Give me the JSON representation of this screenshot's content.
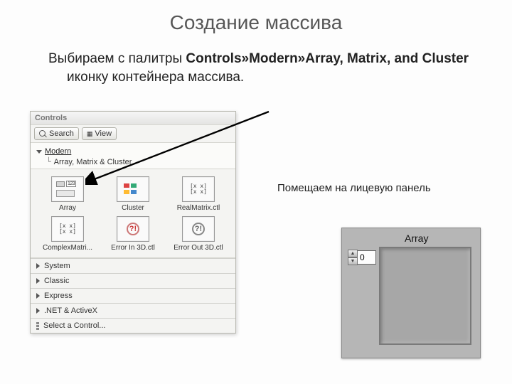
{
  "title": "Создание массива",
  "intro": {
    "pre": "Выбираем с палитры ",
    "bold": "Controls»Modern»Array, Matrix, and Cluster",
    "post": " иконку контейнера массива."
  },
  "palette": {
    "window_title": "Controls",
    "search_label": "Search",
    "view_label": "View",
    "tree": {
      "root": "Modern",
      "sub": "Array, Matrix & Cluster"
    },
    "items": [
      {
        "label": "Array"
      },
      {
        "label": "Cluster"
      },
      {
        "label": "RealMatrix.ctl"
      },
      {
        "label": "ComplexMatri..."
      },
      {
        "label": "Error In 3D.ctl"
      },
      {
        "label": "Error Out 3D.ctl"
      }
    ],
    "categories": [
      "System",
      "Classic",
      "Express",
      ".NET & ActiveX",
      "Select a Control..."
    ]
  },
  "caption": "Помещаем на лицевую панель",
  "panel": {
    "label": "Array",
    "index_value": "0"
  }
}
